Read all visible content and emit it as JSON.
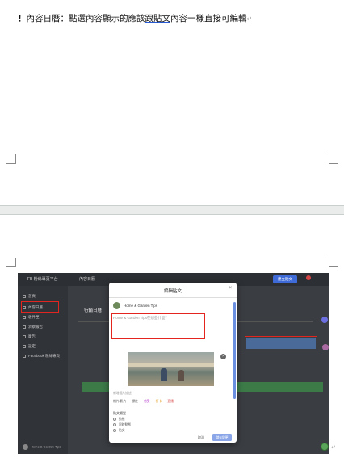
{
  "note": {
    "bang": "！",
    "prefix": "內容日曆：點選內容顯示的應該",
    "underlined": "跟貼文",
    "suffix": "內容一樣直接可編輯",
    "para_mark": "↵"
  },
  "screenshot": {
    "brand": "FB 粉絲專頁平台",
    "top_nav": "內容日曆",
    "top_button": "建立貼文",
    "section_title": "行銷日曆",
    "sidebar_items": [
      "首頁",
      "內容日曆",
      "收件匣",
      "洞察報告",
      "廣告",
      "設定",
      "Facebook 粉絲專頁"
    ],
    "sidebar_user": "Home & Garden Tips",
    "modal": {
      "title": "編輯貼文",
      "close": "×",
      "page_name": "Home & Garden Tips",
      "placeholder": "Home & Garden Tips在想些什麼？",
      "remove": "×",
      "desc": "新增圖片描述",
      "tools": [
        "相片/影片",
        "標註",
        "感受",
        "打卡",
        "直播"
      ],
      "options_heading": "貼文類型",
      "options": [
        "動態",
        "限時動態",
        "貼文"
      ],
      "cancel": "取消",
      "publish": "儲存變更"
    },
    "accent": "#3f6bd8",
    "highlight_color": "#e2261f"
  },
  "page2_para_mark": "↵"
}
